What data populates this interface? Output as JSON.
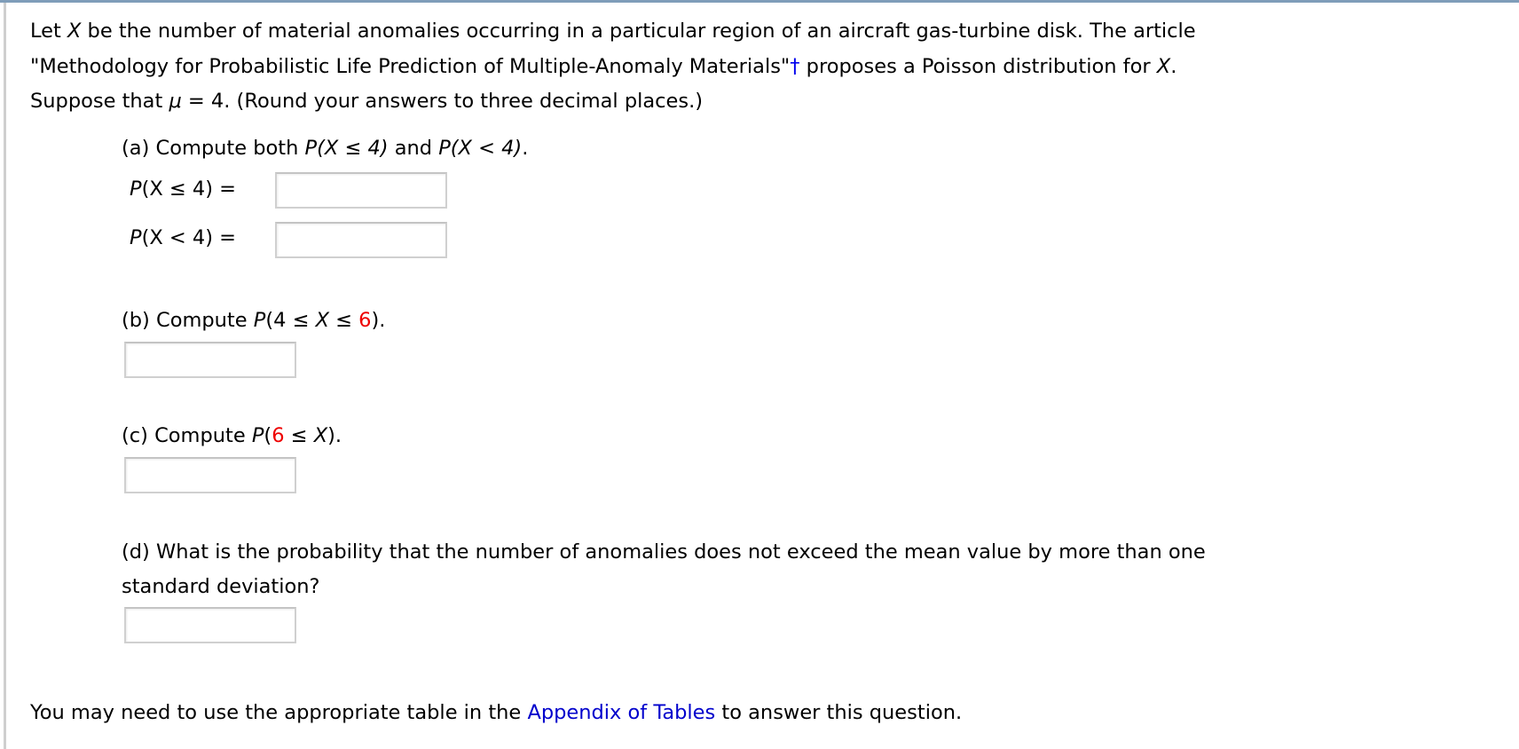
{
  "intro": {
    "line1_a": "Let ",
    "var_x": "X",
    "line1_b": " be the number of material anomalies occurring in a particular region of an aircraft gas-turbine disk. The article",
    "line2_a": "\"Methodology for Probabilistic Life Prediction of Multiple-Anomaly Materials\"",
    "dagger": "†",
    "line2_b": " proposes a Poisson distribution for ",
    "line2_c": ".",
    "line3_a": "Suppose that ",
    "mu": "μ",
    "line3_b": " = 4. (Round your answers to three decimal places.)"
  },
  "part_a": {
    "label": "(a) Compute both ",
    "expr1": "P(X ≤ 4)",
    "and": " and ",
    "expr2": "P(X < 4)",
    "end": ".",
    "row1_label_p": "P",
    "row1_label_rest": "(X ≤ 4) =",
    "row2_label_p": "P",
    "row2_label_rest": "(X < 4) =",
    "answer1": "",
    "answer2": ""
  },
  "part_b": {
    "label": "(b) Compute ",
    "expr_a": "P",
    "expr_b": "(4 ≤ ",
    "expr_x": "X",
    "expr_c": " ≤ ",
    "expr_red": "6",
    "expr_d": ").",
    "answer": ""
  },
  "part_c": {
    "label": "(c) Compute ",
    "expr_a": "P",
    "expr_b": "(",
    "expr_red": "6",
    "expr_c": " ≤ ",
    "expr_x": "X",
    "expr_d": ").",
    "answer": ""
  },
  "part_d": {
    "line1": "(d) What is the probability that the number of anomalies does not exceed the mean value by more than one",
    "line2": "standard deviation?",
    "answer": ""
  },
  "footer": {
    "text_a": "You may need to use the appropriate table in the ",
    "link": "Appendix of Tables",
    "text_b": " to answer this question."
  },
  "colors": {
    "link": "#0000cc",
    "highlight": "#ee0000",
    "top_bar": "#7f9db9"
  }
}
